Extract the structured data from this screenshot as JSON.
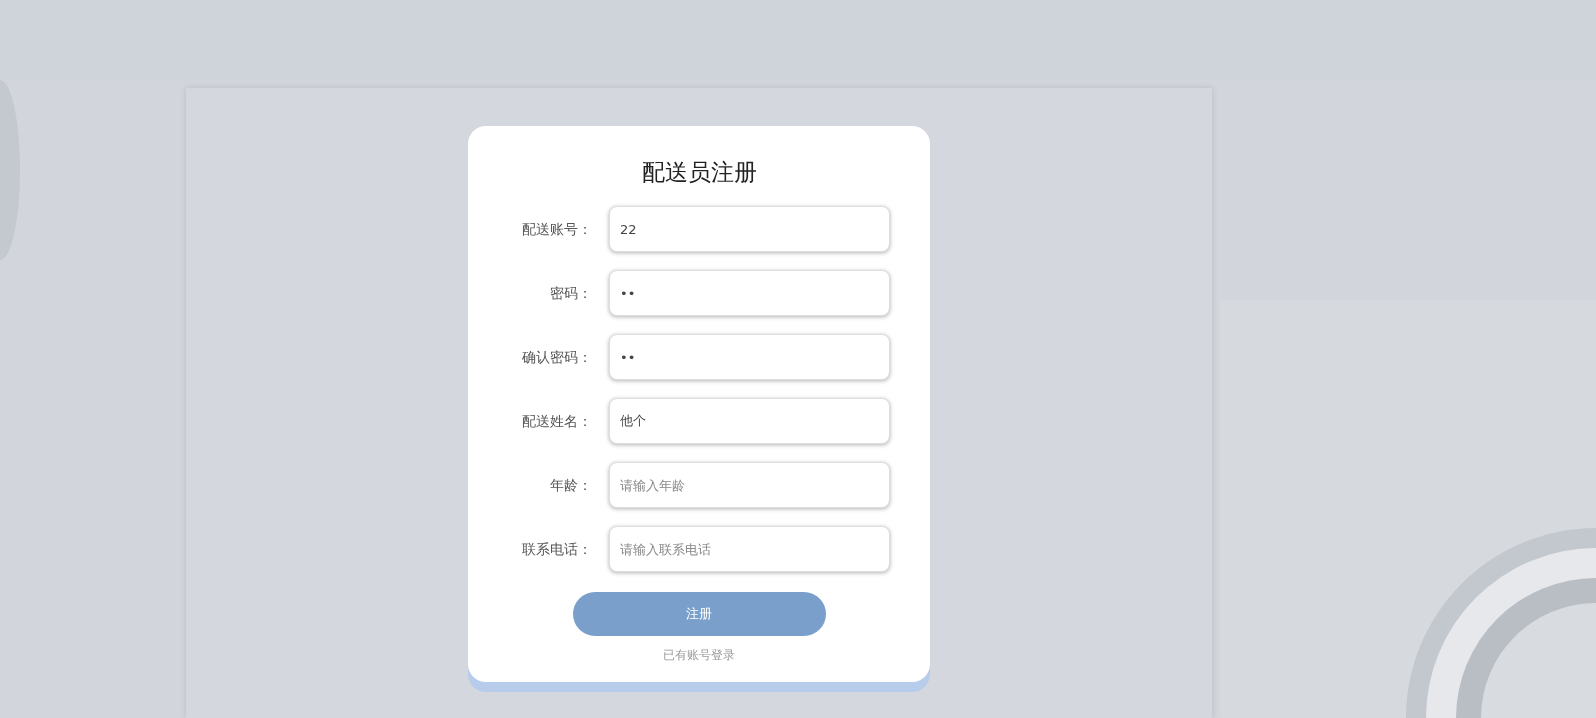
{
  "form": {
    "title": "配送员注册",
    "fields": [
      {
        "label": "配送账号：",
        "value": "22"
      },
      {
        "label": "密码：",
        "value": "••"
      },
      {
        "label": "确认密码：",
        "value": "••"
      },
      {
        "label": "配送姓名：",
        "value": "他个"
      },
      {
        "label": "年龄：",
        "placeholder": "请输入年龄"
      },
      {
        "label": "联系电话：",
        "placeholder": "请输入联系电话"
      }
    ],
    "submit": "注册",
    "login_link": "已有账号登录"
  }
}
